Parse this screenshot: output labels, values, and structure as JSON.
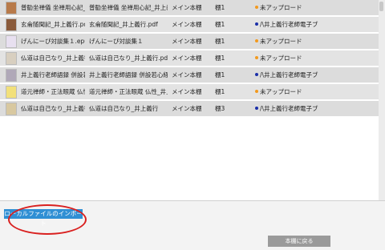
{
  "colors": {
    "status_orange": "#f29a1f",
    "status_blue": "#1b2fa8",
    "import_button": "#2f8fd4",
    "back_button": "#9a9a9a",
    "annotation": "#d9201f"
  },
  "book_rows": [
    {
      "title": "普勧坐禅儀 坐禅用心記_井…",
      "file": "普勧坐禅儀 坐禅用心記_井上義行",
      "location": "メイン本棚",
      "shelf": "棚1",
      "status": "未アップロード",
      "status_color": "orange",
      "thumb": "#b87a4a"
    },
    {
      "title": "玄侖随聞記_井上義行.pdf",
      "file": "玄侖随聞記_井上義行.pdf",
      "location": "メイン本棚",
      "shelf": "棚1",
      "status": "/\\井上義行老師電子ブ",
      "status_color": "blue",
      "thumb": "#8a5a3a"
    },
    {
      "title": "げんにーぴ対談集１.epub",
      "file": "げんにーぴ対談集１",
      "location": "メイン本棚",
      "shelf": "棚1",
      "status": "未アップロード",
      "status_color": "orange",
      "thumb": "#e8e0f0"
    },
    {
      "title": "仏道は自己なり_井上義行.pdf",
      "file": "仏道は自己なり_井上義行.pdf",
      "location": "メイン本棚",
      "shelf": "棚1",
      "status": "未アップロード",
      "status_color": "orange",
      "thumb": "#d8cfc0"
    },
    {
      "title": "井上義行老師語録 併設若心経講…",
      "file": "井上義行老師語録 併設若心経講…",
      "location": "メイン本棚",
      "shelf": "棚1",
      "status": "/\\井上義行老師電子ブ",
      "status_color": "blue",
      "thumb": "#b0a8b8"
    },
    {
      "title": "道元禅師・正法眼蔵 仏性…",
      "file": "道元禅師・正法眼蔵 仏性_井上義…",
      "location": "メイン本棚",
      "shelf": "棚1",
      "status": "未アップロード",
      "status_color": "orange",
      "thumb": "#f2e07a"
    },
    {
      "title": "仏道は自己なり_井上義行…",
      "file": "仏道は自己なり_井上義行",
      "location": "メイン本棚",
      "shelf": "棚3",
      "status": "/\\井上義行老師電子ブ",
      "status_color": "blue",
      "thumb": "#d8c8a0"
    }
  ],
  "buttons": {
    "import_label": "ローカルファイルのインポート",
    "back_label": "本棚に戻る"
  }
}
